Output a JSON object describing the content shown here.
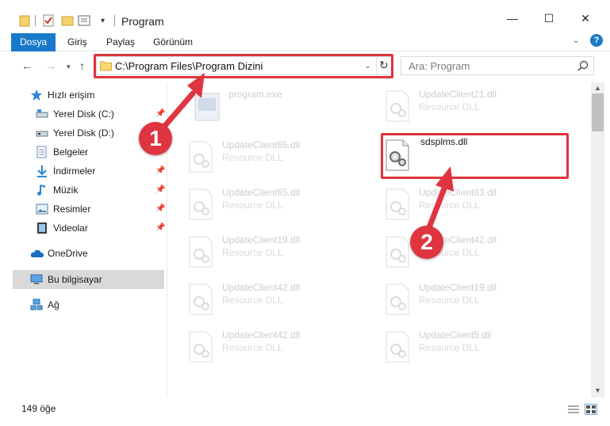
{
  "window": {
    "title": "Program",
    "minimize_glyph": "—",
    "maximize_glyph": "☐",
    "close_glyph": "✕"
  },
  "ribbon": {
    "tabs": [
      "Dosya",
      "Giriş",
      "Paylaş",
      "Görünüm"
    ],
    "help_glyph": "?",
    "accent_color": "#1979ca"
  },
  "address_bar": {
    "path": "C:\\Program Files\\Program Dizini"
  },
  "search": {
    "placeholder": "Ara: Program"
  },
  "nav_pane": {
    "items": [
      {
        "label": "Hızlı erişim",
        "icon": "star-icon"
      },
      {
        "label": "Yerel Disk (C:)",
        "icon": "drive-icon",
        "pinned": true
      },
      {
        "label": "Yerel Disk (D:)",
        "icon": "drive-icon"
      },
      {
        "label": "Belgeler",
        "icon": "documents-icon"
      },
      {
        "label": "İndirmeler",
        "icon": "download-icon",
        "pinned": true
      },
      {
        "label": "Müzik",
        "icon": "music-icon",
        "pinned": true
      },
      {
        "label": "Resimler",
        "icon": "pictures-icon",
        "pinned": true
      },
      {
        "label": "Videolar",
        "icon": "videos-icon",
        "pinned": true
      },
      {
        "label": "OneDrive",
        "icon": "cloud-icon"
      },
      {
        "label": "Bu bilgisayar",
        "icon": "computer-icon",
        "selected": true
      },
      {
        "label": "Ağ",
        "icon": "network-icon"
      }
    ]
  },
  "files": [
    {
      "name": "program.exe",
      "type": ""
    },
    {
      "name": "UpdateClient21.dll",
      "type": "Resource DLL"
    },
    {
      "name": "UpdateClient65.dll",
      "type": "Resource DLL"
    },
    {
      "name": "sdsplms.dll",
      "type": "",
      "highlighted": true
    },
    {
      "name": "UpdateClient65.dll",
      "type": "Resource DLL"
    },
    {
      "name": "UpdateClient63.dll",
      "type": "Resource DLL"
    },
    {
      "name": "UpdateClient19.dll",
      "type": "Resource DLL"
    },
    {
      "name": "UpdateClient42.dll",
      "type": "Resource DLL"
    },
    {
      "name": "UpdateClient42.dll",
      "type": "Resource DLL"
    },
    {
      "name": "UpdateClient19.dll",
      "type": "Resource DLL"
    },
    {
      "name": "UpdateClient42.dll",
      "type": "Resource DLL"
    },
    {
      "name": "UpdateClient5.dll",
      "type": "Resource DLL"
    }
  ],
  "status": {
    "count": "149 öğe"
  },
  "annotations": {
    "step1": "1",
    "step2": "2",
    "color": "#e0333d"
  }
}
